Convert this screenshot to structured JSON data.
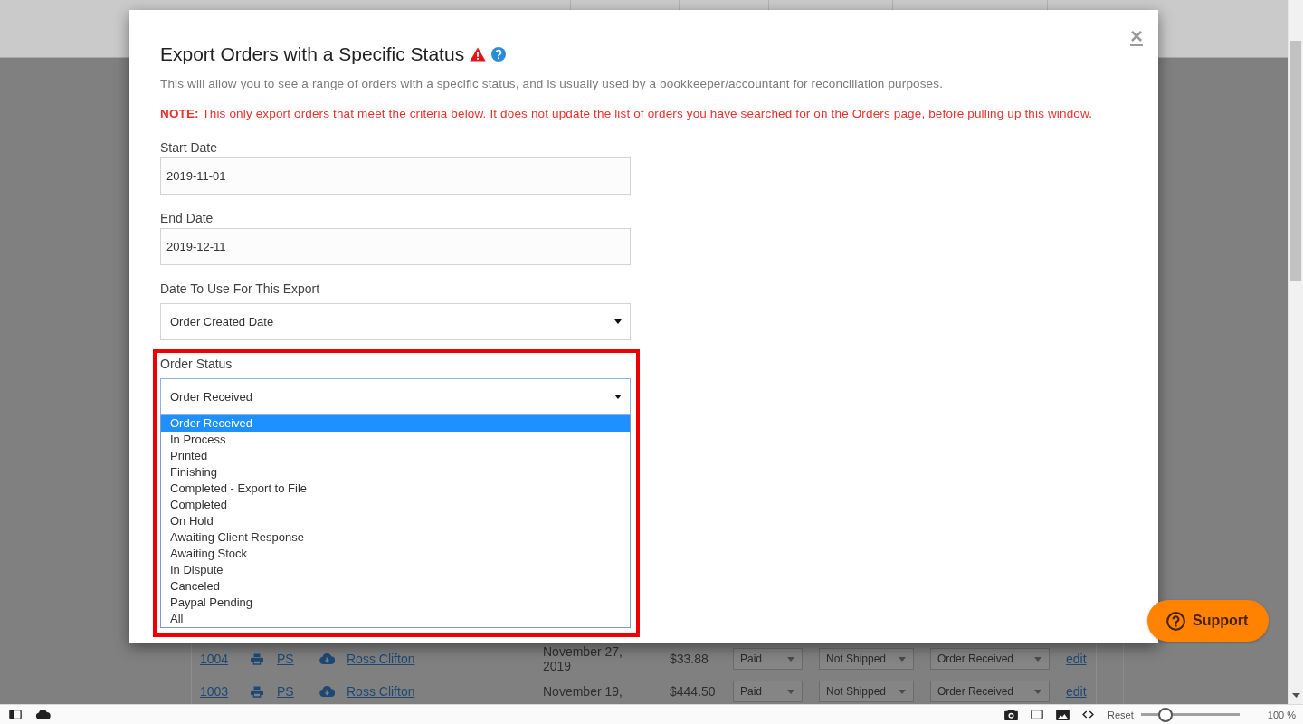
{
  "orders_table": {
    "rows": [
      {
        "order_number": "1004",
        "code": "PS",
        "customer": "Ross Clifton",
        "date": "November 27, 2019",
        "total": "$33.88",
        "payment": "Paid",
        "shipping": "Not Shipped",
        "status": "Order Received",
        "action": "edit"
      },
      {
        "order_number": "1003",
        "code": "PS",
        "customer": "Ross Clifton",
        "date": "November 19,",
        "total": "$444.50",
        "payment": "Paid",
        "shipping": "Not Shipped",
        "status": "Order Received",
        "action": "edit"
      }
    ]
  },
  "export_dialog": {
    "title": "Export Orders with a Specific Status",
    "close_label": "×",
    "description": "This will allow you to see a range of orders with a specific status, and is usually used by a bookkeeper/accountant for reconciliation purposes.",
    "note": "**NOTE:** This only export orders that meet the criteria below. It does not update the list of orders you have searched for on the Orders page, before pulling up this window.",
    "fields": [
      {
        "kind": "input",
        "label": "Start Date",
        "value": "2019-11-01",
        "focused": false,
        "highlighted": false
      },
      {
        "kind": "input",
        "label": "End Date",
        "value": "2019-12-11",
        "focused": false,
        "highlighted": false
      },
      {
        "kind": "select",
        "label": "Date To Use For This Export",
        "value": "Order Created Date",
        "focused": false,
        "highlighted": false
      },
      {
        "kind": "select",
        "label": "Order Status",
        "value": "Order Received",
        "focused": true,
        "expanded": true,
        "highlighted": true,
        "options": [
          {
            "label": "Order Received",
            "selected": true
          },
          {
            "label": "In Process",
            "selected": false
          },
          {
            "label": "Printed",
            "selected": false
          },
          {
            "label": "Finishing",
            "selected": false
          },
          {
            "label": "Completed - Export to File",
            "selected": false
          },
          {
            "label": "Completed",
            "selected": false
          },
          {
            "label": "On Hold",
            "selected": false
          },
          {
            "label": "Awaiting Client Response",
            "selected": false
          },
          {
            "label": "Awaiting Stock",
            "selected": false
          },
          {
            "label": "In Dispute",
            "selected": false
          },
          {
            "label": "Canceled",
            "selected": false
          },
          {
            "label": "Paypal Pending",
            "selected": false
          },
          {
            "label": "All",
            "selected": false
          }
        ]
      }
    ]
  },
  "support_button": {
    "label": "Support"
  },
  "status_bar": {
    "reset_label": "Reset",
    "zoom_slider": {
      "level": 0.25
    },
    "zoom_reading": "100 %"
  }
}
